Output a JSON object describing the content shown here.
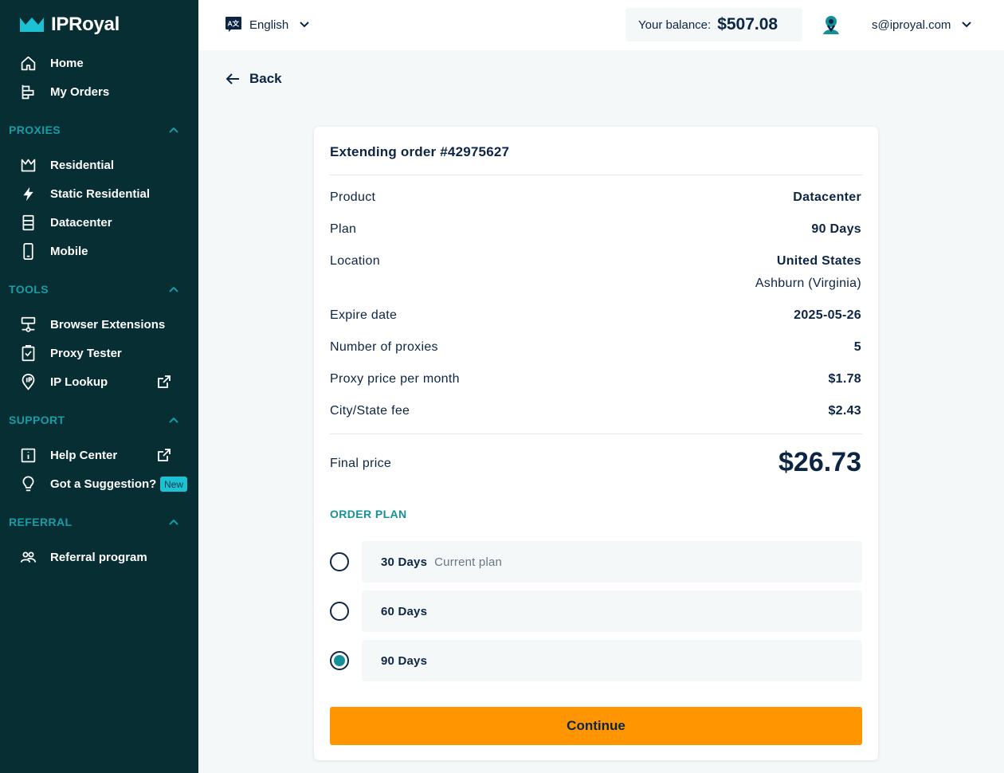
{
  "app": {
    "logo_text": "IPRoyal",
    "colors": {
      "sidebar_bg": "#062e33",
      "accent": "#199ca5",
      "cta": "#ff9500",
      "text": "#0d2545"
    }
  },
  "sidebar": {
    "main": [
      {
        "label": "Home",
        "icon": "home-icon"
      },
      {
        "label": "My Orders",
        "icon": "orders-icon"
      }
    ],
    "sections": [
      {
        "title": "PROXIES",
        "items": [
          {
            "label": "Residential",
            "icon": "crown-icon"
          },
          {
            "label": "Static Residential",
            "icon": "bolt-icon"
          },
          {
            "label": "Datacenter",
            "icon": "server-icon"
          },
          {
            "label": "Mobile",
            "icon": "mobile-icon"
          }
        ]
      },
      {
        "title": "TOOLS",
        "items": [
          {
            "label": "Browser Extensions",
            "icon": "network-icon"
          },
          {
            "label": "Proxy Tester",
            "icon": "checklist-icon"
          },
          {
            "label": "IP Lookup",
            "icon": "ip-pin-icon"
          }
        ]
      },
      {
        "title": "SUPPORT",
        "items": [
          {
            "label": "Help Center",
            "icon": "info-icon"
          },
          {
            "label": "Got a Suggestion?",
            "icon": "lightbulb-icon",
            "badge": "New"
          }
        ]
      },
      {
        "title": "REFERRAL",
        "items": [
          {
            "label": "Referral program",
            "icon": "users-icon"
          }
        ]
      }
    ]
  },
  "topbar": {
    "language": "English",
    "balance_label": "Your balance:",
    "balance_value": "$507.08",
    "user_email": "s@iproyal.com"
  },
  "back_label": "Back",
  "order": {
    "title": "Extending order #42975627",
    "rows": [
      {
        "label": "Product",
        "value": "Datacenter"
      },
      {
        "label": "Plan",
        "value": "90 Days"
      },
      {
        "label": "Location",
        "value": "United States",
        "sub": "Ashburn (Virginia)"
      },
      {
        "label": "Expire date",
        "value": "2025-05-26"
      },
      {
        "label": "Number of proxies",
        "value": "5"
      },
      {
        "label": "Proxy price per month",
        "value": "$1.78"
      },
      {
        "label": "City/State fee",
        "value": "$2.43"
      }
    ],
    "final_label": "Final price",
    "final_value": "$26.73",
    "plan_header": "ORDER PLAN",
    "plans": [
      {
        "name": "30 Days",
        "note": "Current plan",
        "selected": false
      },
      {
        "name": "60 Days",
        "note": "",
        "selected": false
      },
      {
        "name": "90 Days",
        "note": "",
        "selected": true
      }
    ],
    "continue_label": "Continue"
  }
}
